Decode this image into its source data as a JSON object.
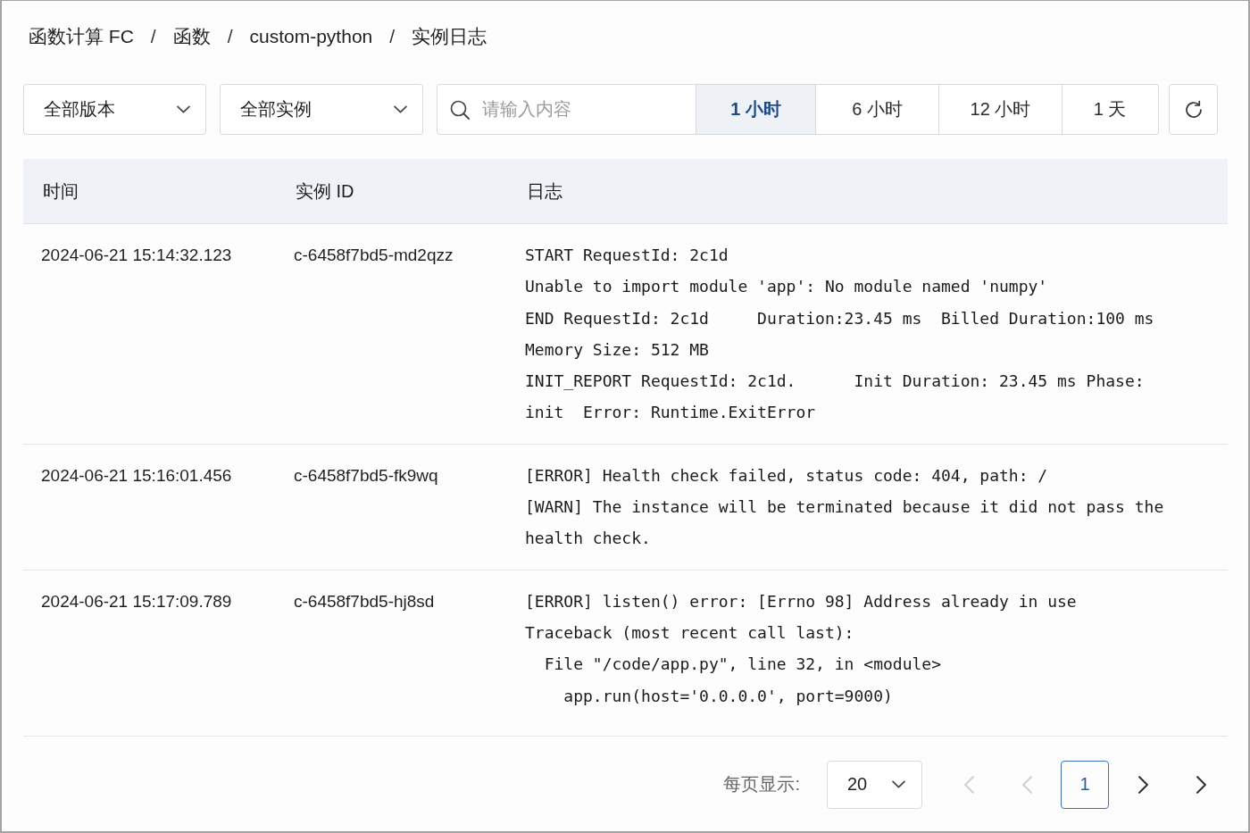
{
  "breadcrumb": [
    {
      "kind": "item",
      "text": "函数计算 FC"
    },
    {
      "kind": "separator",
      "text": "/"
    },
    {
      "kind": "item",
      "text": "函数"
    },
    {
      "kind": "separator",
      "text": "/"
    },
    {
      "kind": "item",
      "text": "custom-python"
    },
    {
      "kind": "separator",
      "text": "/"
    },
    {
      "kind": "item",
      "text": "实例日志"
    }
  ],
  "filters": {
    "version_select": {
      "value": "全部版本"
    },
    "instance_select": {
      "value": "全部实例"
    },
    "search": {
      "placeholder": "请输入内容"
    },
    "time_ranges": [
      {
        "label": "1 小时",
        "selected": true
      },
      {
        "label": "6 小时",
        "selected": false
      },
      {
        "label": "12 小时",
        "selected": false
      },
      {
        "label": "1 天",
        "selected": false
      }
    ]
  },
  "table": {
    "columns": [
      "时间",
      "实例 ID",
      "日志"
    ],
    "rows": [
      {
        "time": "2024-06-21 15:14:32.123",
        "instance_id": "c-6458f7bd5-md2qzz",
        "log_lines": [
          "START RequestId: 2c1d",
          "Unable to import module 'app': No module named 'numpy'",
          "END RequestId: 2c1d     Duration:23.45 ms  Billed Duration:100 ms",
          "Memory Size: 512 MB",
          "INIT_REPORT RequestId: 2c1d.      Init Duration: 23.45 ms Phase:",
          "init  Error: Runtime.ExitError"
        ]
      },
      {
        "time": "2024-06-21 15:16:01.456",
        "instance_id": "c-6458f7bd5-fk9wq",
        "log_lines": [
          "[ERROR] Health check failed, status code: 404, path: /",
          "[WARN] The instance will be terminated because it did not pass the",
          "health check."
        ]
      },
      {
        "time": "2024-06-21 15:17:09.789",
        "instance_id": "c-6458f7bd5-hj8sd",
        "log_lines": [
          "[ERROR] listen() error: [Errno 98] Address already in use",
          "Traceback (most recent call last):",
          "  File \"/code/app.py\", line 32, in <module>",
          "    app.run(host='0.0.0.0', port=9000)"
        ]
      }
    ]
  },
  "pagination": {
    "page_size_label": "每页显示:",
    "page_size": "20",
    "buttons": [
      {
        "kind": "first",
        "disabled": true
      },
      {
        "kind": "prev",
        "disabled": true
      },
      {
        "kind": "next",
        "disabled": false
      },
      {
        "kind": "last",
        "disabled": false
      }
    ],
    "pages": [
      {
        "label": "1",
        "selected": true
      }
    ]
  }
}
